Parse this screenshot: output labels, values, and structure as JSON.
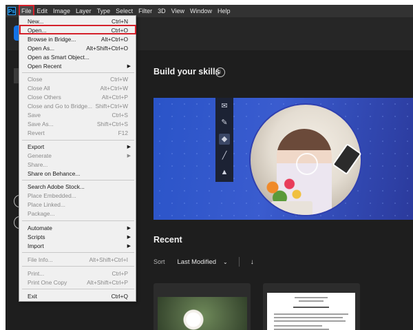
{
  "menubar": {
    "logo": "Ps",
    "items": [
      "File",
      "Edit",
      "Image",
      "Layer",
      "Type",
      "Select",
      "Filter",
      "3D",
      "View",
      "Window",
      "Help"
    ]
  },
  "main": {
    "build_skills_title": "Build your skills",
    "info_glyph": "i",
    "recent_title": "Recent",
    "sort_label": "Sort",
    "sort_value": "Last Modified",
    "sort_chevron": "⌄",
    "sort_direction": "↓"
  },
  "file_menu": {
    "items": [
      {
        "label": "New...",
        "shortcut": "Ctrl+N",
        "enabled": true
      },
      {
        "label": "Open...",
        "shortcut": "Ctrl+O",
        "enabled": true
      },
      {
        "label": "Browse in Bridge...",
        "shortcut": "Alt+Ctrl+O",
        "enabled": true
      },
      {
        "label": "Open As...",
        "shortcut": "Alt+Shift+Ctrl+O",
        "enabled": true
      },
      {
        "label": "Open as Smart Object...",
        "shortcut": "",
        "enabled": true
      },
      {
        "label": "Open Recent",
        "shortcut": "",
        "enabled": true,
        "submenu": true
      },
      {
        "label": "Close",
        "shortcut": "Ctrl+W",
        "enabled": false
      },
      {
        "label": "Close All",
        "shortcut": "Alt+Ctrl+W",
        "enabled": false
      },
      {
        "label": "Close Others",
        "shortcut": "Alt+Ctrl+P",
        "enabled": false
      },
      {
        "label": "Close and Go to Bridge...",
        "shortcut": "Shift+Ctrl+W",
        "enabled": false
      },
      {
        "label": "Save",
        "shortcut": "Ctrl+S",
        "enabled": false
      },
      {
        "label": "Save As...",
        "shortcut": "Shift+Ctrl+S",
        "enabled": false
      },
      {
        "label": "Revert",
        "shortcut": "F12",
        "enabled": false
      },
      {
        "label": "Export",
        "shortcut": "",
        "enabled": true,
        "submenu": true
      },
      {
        "label": "Generate",
        "shortcut": "",
        "enabled": false,
        "submenu": true
      },
      {
        "label": "Share...",
        "shortcut": "",
        "enabled": false
      },
      {
        "label": "Share on Behance...",
        "shortcut": "",
        "enabled": true
      },
      {
        "label": "Search Adobe Stock...",
        "shortcut": "",
        "enabled": true
      },
      {
        "label": "Place Embedded...",
        "shortcut": "",
        "enabled": false
      },
      {
        "label": "Place Linked...",
        "shortcut": "",
        "enabled": false
      },
      {
        "label": "Package...",
        "shortcut": "",
        "enabled": false
      },
      {
        "label": "Automate",
        "shortcut": "",
        "enabled": true,
        "submenu": true
      },
      {
        "label": "Scripts",
        "shortcut": "",
        "enabled": true,
        "submenu": true
      },
      {
        "label": "Import",
        "shortcut": "",
        "enabled": true,
        "submenu": true
      },
      {
        "label": "File Info...",
        "shortcut": "Alt+Shift+Ctrl+I",
        "enabled": false
      },
      {
        "label": "Print...",
        "shortcut": "Ctrl+P",
        "enabled": false
      },
      {
        "label": "Print One Copy",
        "shortcut": "Alt+Shift+Ctrl+P",
        "enabled": false
      },
      {
        "label": "Exit",
        "shortcut": "Ctrl+Q",
        "enabled": true
      }
    ],
    "submenu_glyph": "▶"
  },
  "colors": {
    "accent": "#1473e6",
    "highlight": "#d4202a",
    "menubar": "#323232",
    "workspace": "#1e1e1e",
    "menu_bg": "#f0f0f0"
  },
  "icons": {
    "hero_tools": [
      "envelope-icon",
      "eyedropper-icon",
      "eraser-icon",
      "brush-icon",
      "stamp-icon"
    ]
  }
}
